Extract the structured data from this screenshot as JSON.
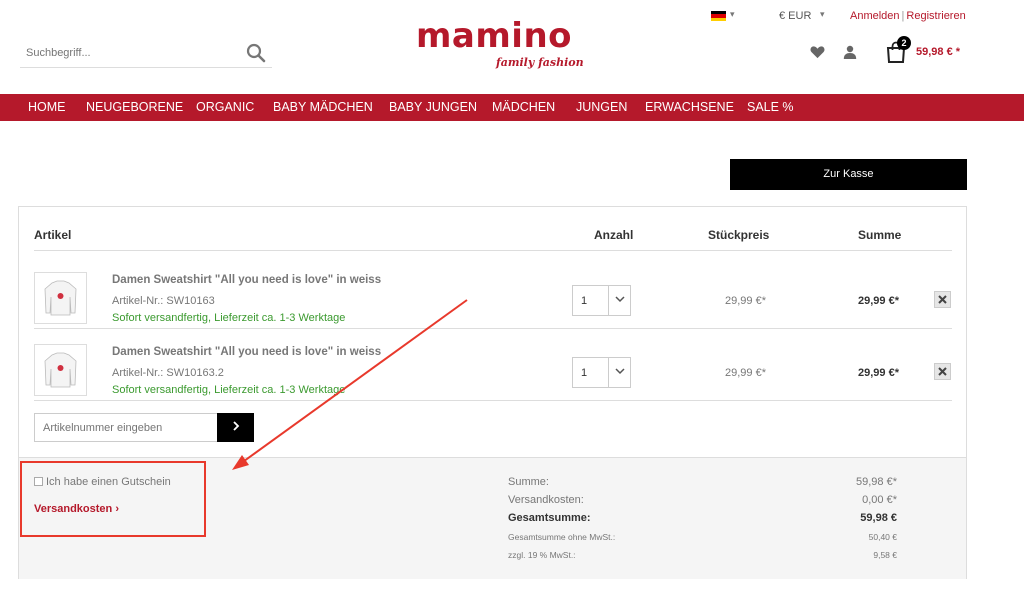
{
  "header": {
    "currency": "€ EUR",
    "login": "Anmelden",
    "separator": "|",
    "register": "Registrieren",
    "search_placeholder": "Suchbegriff...",
    "logo_main": "mamino",
    "logo_sub": "family fashion",
    "cart_count": "2",
    "cart_total": "59,98 € *"
  },
  "nav": [
    "HOME",
    "NEUGEBORENE",
    "ORGANIC",
    "BABY MÄDCHEN",
    "BABY JUNGEN",
    "MÄDCHEN",
    "JUNGEN",
    "ERWACHSENE",
    "SALE %"
  ],
  "checkout_label": "Zur Kasse",
  "cart": {
    "columns": {
      "article": "Artikel",
      "qty": "Anzahl",
      "unit": "Stückpreis",
      "sum": "Summe"
    },
    "items": [
      {
        "name": "Damen Sweatshirt \"All you need is love\" in weiss",
        "sku": "Artikel-Nr.: SW10163",
        "availability": "Sofort versandfertig, Lieferzeit ca. 1-3 Werktage",
        "qty": "1",
        "unit_price": "29,99 €*",
        "total": "29,99 €*"
      },
      {
        "name": "Damen Sweatshirt \"All you need is love\" in weiss",
        "sku": "Artikel-Nr.: SW10163.2",
        "availability": "Sofort versandfertig, Lieferzeit ca. 1-3 Werktage",
        "qty": "1",
        "unit_price": "29,99 €*",
        "total": "29,99 €*"
      }
    ],
    "sku_placeholder": "Artikelnummer eingeben"
  },
  "summary": {
    "voucher_label": "Ich habe einen Gutschein",
    "shipping_link": "Versandkosten",
    "rows": [
      {
        "label": "Summe:",
        "value": "59,98 €*"
      },
      {
        "label": "Versandkosten:",
        "value": "0,00 €*"
      },
      {
        "label": "Gesamtsumme:",
        "value": "59,98 €"
      },
      {
        "label": "Gesamtsumme ohne MwSt.:",
        "value": "50,40 €"
      },
      {
        "label": "zzgl. 19 % MwSt.:",
        "value": "9,58 €"
      }
    ]
  },
  "colors": {
    "brand": "#b5192b",
    "available": "#3b9a2f",
    "annotation": "#e8392c"
  },
  "icons": [
    "de-flag-icon",
    "chevron-down-icon",
    "search-icon",
    "heart-icon",
    "user-icon",
    "cart-icon",
    "chevron-right-icon",
    "close-icon"
  ]
}
